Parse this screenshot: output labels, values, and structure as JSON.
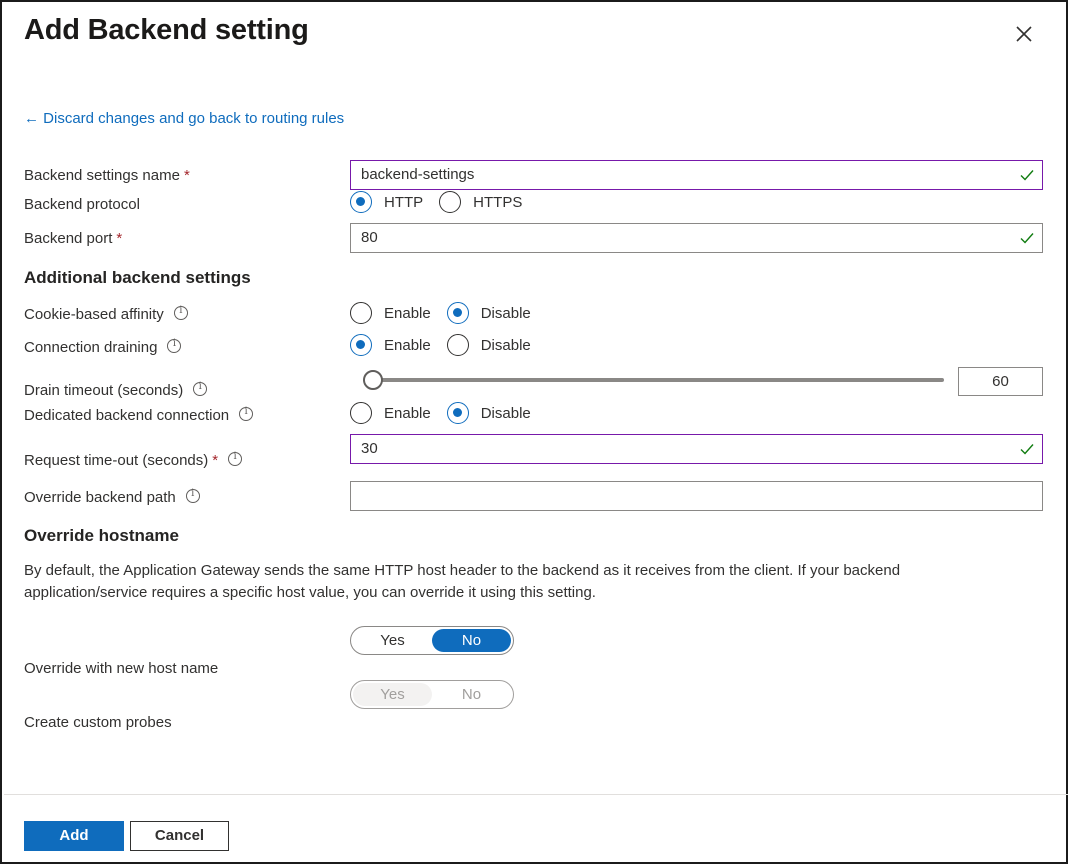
{
  "dialog": {
    "title": "Add Backend setting",
    "close_icon": "close-icon"
  },
  "back_link": {
    "arrow": "←",
    "label": "Discard changes and go back to routing rules"
  },
  "fields": {
    "settings_name": {
      "label": "Backend settings name",
      "required": "*",
      "value": "backend-settings"
    },
    "protocol": {
      "label": "Backend protocol",
      "options": [
        "HTTP",
        "HTTPS"
      ],
      "selected": "HTTP"
    },
    "port": {
      "label": "Backend port",
      "required": "*",
      "value": "80"
    }
  },
  "additional": {
    "heading": "Additional backend settings",
    "cookie_affinity": {
      "label": "Cookie-based affinity",
      "options": [
        "Enable",
        "Disable"
      ],
      "selected": "Disable"
    },
    "connection_draining": {
      "label": "Connection draining",
      "options": [
        "Enable",
        "Disable"
      ],
      "selected": "Enable"
    },
    "drain_timeout": {
      "label": "Drain timeout (seconds)",
      "value": "60",
      "slider_fraction": 0
    },
    "dedicated_connection": {
      "label": "Dedicated backend connection",
      "options": [
        "Enable",
        "Disable"
      ],
      "selected": "Disable"
    },
    "request_timeout": {
      "label": "Request time-out (seconds)",
      "required": "*",
      "value": "30"
    },
    "override_path": {
      "label": "Override backend path",
      "value": ""
    }
  },
  "override_hostname": {
    "heading": "Override hostname",
    "description": "By default, the Application Gateway sends the same HTTP host header to the backend as it receives from the client. If your backend application/service requires a specific host value, you can override it using this setting.",
    "new_host_name": {
      "label": "Override with new host name",
      "options": [
        "Yes",
        "No"
      ],
      "selected": "No"
    },
    "custom_probes": {
      "label": "Create custom probes",
      "options": [
        "Yes",
        "No"
      ],
      "selected": "Yes",
      "disabled": true
    }
  },
  "footer": {
    "add_label": "Add",
    "cancel_label": "Cancel"
  },
  "colors": {
    "accent": "#0f6cbd",
    "valid_border": "#7719aa",
    "valid_check": "#107c10",
    "required": "#a4262c"
  }
}
